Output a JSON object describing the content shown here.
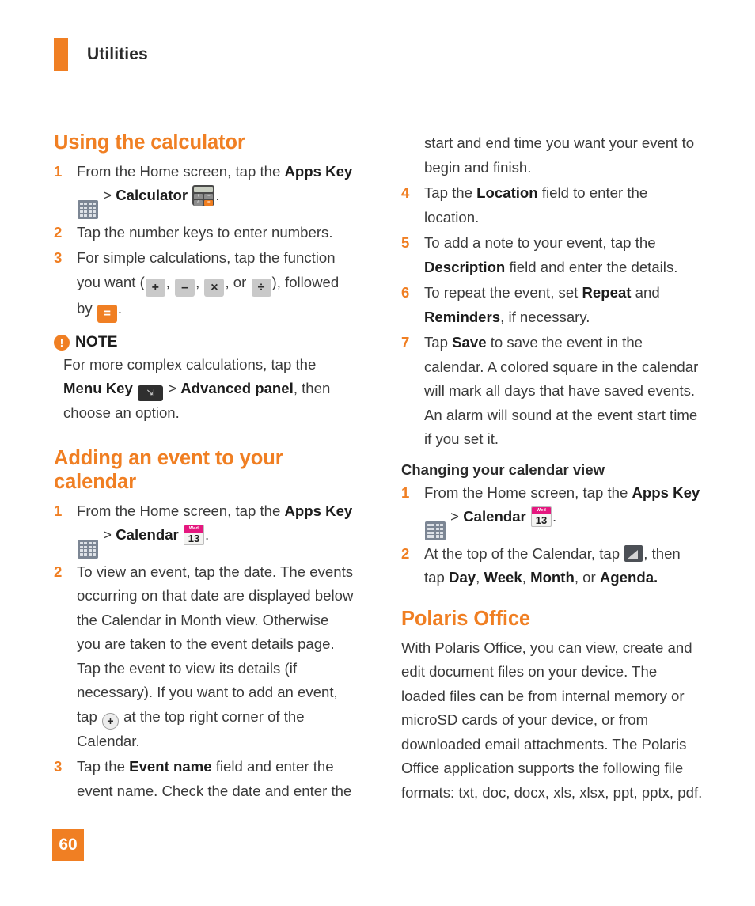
{
  "header": {
    "title": "Utilities",
    "accent_color": "#f07f23"
  },
  "page_number": "60",
  "left_column": {
    "calculator_section": {
      "title": "Using the calculator",
      "steps": [
        {
          "num": "1",
          "text_before": "From the Home screen, tap the ",
          "bold_1": "Apps Key",
          "between": " > ",
          "bold_2": "Calculator",
          "text_after": "."
        },
        {
          "num": "2",
          "text": "Tap the number keys to enter numbers."
        },
        {
          "num": "3",
          "text_before": "For simple calculations, tap the function you want (",
          "key_plus": "+",
          "sep_1": ", ",
          "key_minus": "–",
          "sep_2": ", ",
          "key_times": "×",
          "sep_3": ", or ",
          "key_divide": "÷",
          "text_mid": "), followed by ",
          "key_equals": "=",
          "text_after": "."
        }
      ]
    },
    "note": {
      "icon": "exclamation-circle-icon",
      "label": "NOTE",
      "text_before": "For more complex calculations, tap the ",
      "bold_1": "Menu Key",
      "between": " > ",
      "bold_2": "Advanced panel",
      "text_after": ", then choose an option."
    },
    "calendar_section": {
      "title": "Adding an event to your calendar",
      "steps": [
        {
          "num": "1",
          "text_before": "From the Home screen, tap the ",
          "bold_1": "Apps Key",
          "between": " > ",
          "bold_2": "Calendar",
          "text_after": "."
        },
        {
          "num": "2",
          "text_before": "To view an event, tap the date. The events occurring on that date are displayed below the Calendar in Month view. Otherwise you are taken to the event details page. Tap the event to view its details (if necessary). If you want to add an event, tap ",
          "text_after": " at the top right corner of the Calendar."
        },
        {
          "num": "3",
          "text_before": "Tap the ",
          "bold_1": "Event name",
          "text_after": " field and enter the event name. Check the date and enter the"
        }
      ]
    }
  },
  "right_column": {
    "continuation": "start and end time you want your event to begin and finish.",
    "calendar_steps": [
      {
        "num": "4",
        "text_before": "Tap the ",
        "bold_1": "Location",
        "text_after": " field to enter the location."
      },
      {
        "num": "5",
        "text_before": "To add a note to your event, tap the ",
        "bold_1": "Description",
        "text_after": " field and enter the details."
      },
      {
        "num": "6",
        "text_before": "To repeat the event, set ",
        "bold_1": "Repeat",
        "between": " and ",
        "bold_2": "Reminders",
        "text_after": ", if necessary."
      },
      {
        "num": "7",
        "text_before": "Tap ",
        "bold_1": "Save",
        "text_after": " to save the event in the calendar. A colored square in the calendar will mark all days that have saved events. An alarm will sound at the event start time if you set it."
      }
    ],
    "calendar_view_section": {
      "title": "Changing your calendar view",
      "steps": [
        {
          "num": "1",
          "text_before": "From the Home screen, tap the ",
          "bold_1": "Apps Key",
          "between": " > ",
          "bold_2": "Calendar",
          "text_after": "."
        },
        {
          "num": "2",
          "text_before": "At the top of the Calendar, tap ",
          "text_mid": ", then tap ",
          "bold_1": "Day",
          "sep_1": ", ",
          "bold_2": "Week",
          "sep_2": ", ",
          "bold_3": "Month",
          "sep_3": ", or ",
          "bold_4": "Agenda."
        }
      ]
    },
    "polaris_section": {
      "title": "Polaris Office",
      "body": "With Polaris Office, you can view, create and edit document files on your device. The loaded files can be from internal memory or microSD cards of your device, or from downloaded email attachments. The Polaris Office application supports the following file formats: txt, doc, docx, xls, xlsx, ppt, pptx, pdf."
    }
  },
  "icons": {
    "apps_key": "apps-grid-icon",
    "calculator": "calculator-app-icon",
    "menu_key": "menu-key-icon",
    "calendar": "calendar-app-icon",
    "calendar_day_label": "Wed",
    "calendar_day_number": "13",
    "add_event": "plus-circle-icon",
    "calendar_view_switch": "view-switch-icon"
  }
}
